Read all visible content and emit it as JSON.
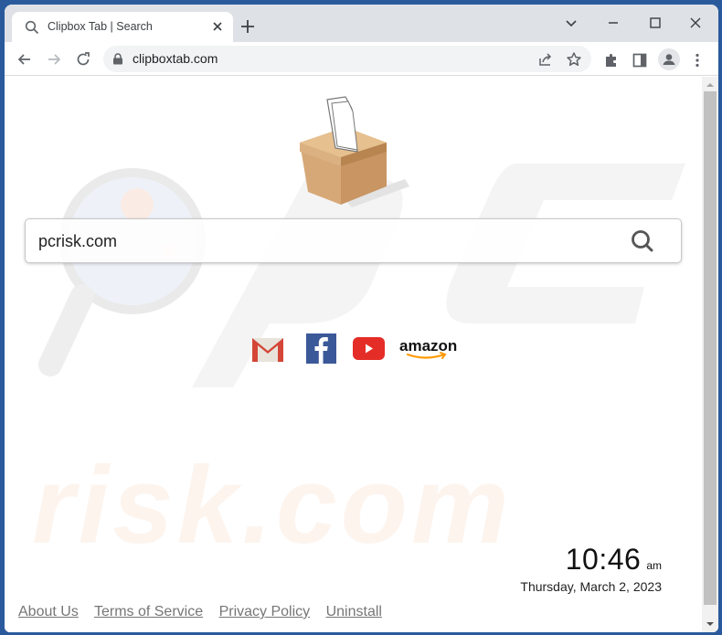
{
  "browser": {
    "tab": {
      "title": "Clipbox Tab | Search",
      "icon": "search-icon"
    },
    "new_tab_icon": "plus-icon",
    "window_controls": [
      "chevron-down-icon",
      "minimize-icon",
      "maximize-icon",
      "close-icon"
    ],
    "address_bar": {
      "url": "clipboxtab.com",
      "secure_icon": "lock-icon"
    },
    "toolbar_icons": [
      "share-icon",
      "star-icon",
      "extensions-icon",
      "side-panel-icon",
      "profile-icon",
      "menu-icon"
    ]
  },
  "page": {
    "logo": "ballot-box-icon",
    "search": {
      "value": "pcrisk.com",
      "placeholder": "",
      "button_icon": "search-icon"
    },
    "shortcuts": [
      {
        "name": "Gmail",
        "icon": "gmail-icon"
      },
      {
        "name": "Facebook",
        "icon": "facebook-icon"
      },
      {
        "name": "YouTube",
        "icon": "youtube-icon"
      },
      {
        "name": "Amazon",
        "label": "amazon",
        "icon": "amazon-icon"
      }
    ],
    "clock": {
      "time": "10:46",
      "ampm": "am",
      "date": "Thursday, March 2, 2023"
    },
    "footer_links": [
      "About Us",
      "Terms of Service",
      "Privacy Policy",
      "Uninstall"
    ],
    "watermark": "pcrisk.com"
  },
  "colors": {
    "frame": "#2a5a9c",
    "tabstrip": "#dee1e6",
    "gmail_red": "#d44638",
    "facebook_blue": "#3b5998",
    "youtube_red": "#e52d27",
    "amazon_orange": "#ff9900",
    "link_gray": "#767676"
  }
}
